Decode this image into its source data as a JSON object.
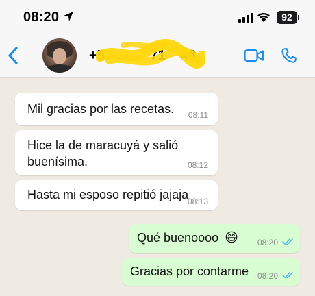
{
  "status_bar": {
    "time": "08:20",
    "battery": "92",
    "icons": [
      "location-arrow-icon",
      "signal-icon",
      "wifi-icon",
      "battery-icon"
    ]
  },
  "header": {
    "contact_name": "+5            71    48",
    "icons": [
      "back-chevron-icon",
      "avatar",
      "video-call-icon",
      "phone-call-icon"
    ]
  },
  "colors": {
    "accent": "#1a8cff",
    "chat_background": "#efeae2",
    "incoming_bubble": "#ffffff",
    "outgoing_bubble": "#d9fdd3",
    "read_ticks": "#53bdeb",
    "redaction": "#ffd60a"
  },
  "messages": [
    {
      "direction": "incoming",
      "text_lines": [
        "Mil gracias por las recetas."
      ],
      "time": "08:11"
    },
    {
      "direction": "incoming",
      "text_lines": [
        "Hice la de maracuyá y salió",
        "buenísima."
      ],
      "time": "08:12"
    },
    {
      "direction": "incoming",
      "text_lines": [
        "Hasta mi esposo repitió jajaja"
      ],
      "time": "08:13"
    },
    {
      "direction": "outgoing",
      "text_lines": [
        "Qué buenoooo"
      ],
      "emoji": "😄",
      "time": "08:20",
      "status": "read"
    },
    {
      "direction": "outgoing",
      "text_lines": [
        "Gracias por contarme"
      ],
      "time": "08:20",
      "status": "read"
    }
  ]
}
